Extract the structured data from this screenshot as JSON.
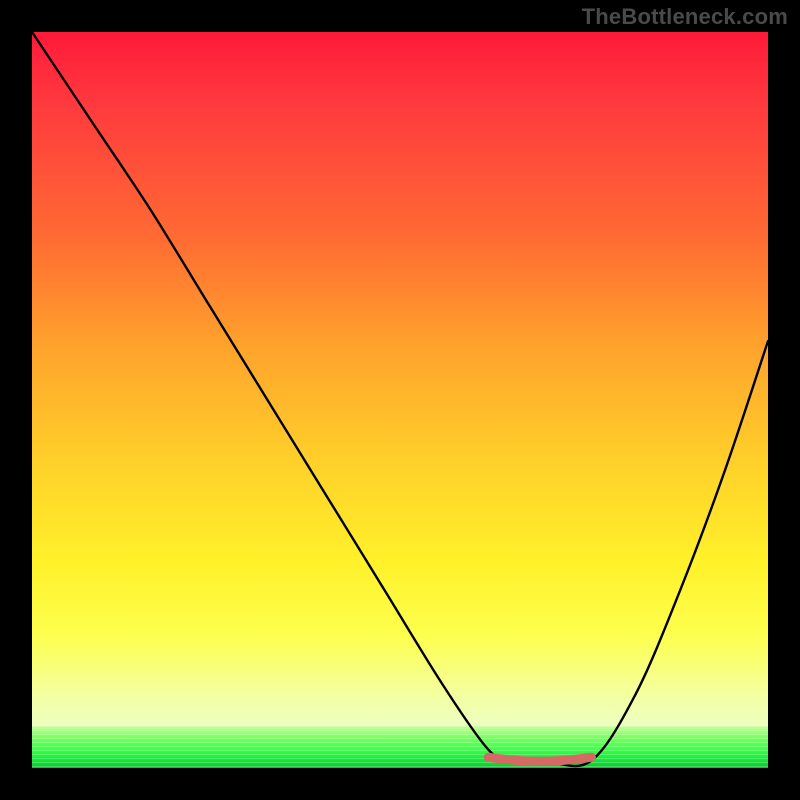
{
  "watermark": "TheBottleneck.com",
  "chart_data": {
    "type": "line",
    "title": "",
    "xlabel": "",
    "ylabel": "",
    "xlim": [
      0,
      100
    ],
    "ylim": [
      0,
      100
    ],
    "series": [
      {
        "name": "bottleneck-curve",
        "x": [
          0,
          8,
          16,
          24,
          32,
          40,
          48,
          56,
          62,
          65,
          70,
          76,
          82,
          88,
          94,
          100
        ],
        "values": [
          100,
          88,
          76,
          63,
          50,
          37,
          24,
          11,
          2.5,
          1,
          0.8,
          1,
          10,
          24,
          40,
          58
        ]
      }
    ],
    "marker": {
      "name": "optimal-range",
      "x_start": 62,
      "x_end": 76,
      "y": 1.2,
      "color": "#d46a63"
    },
    "background_gradient": {
      "top": "#ff1a3a",
      "mid": "#ffcf2a",
      "bottom": "#0cc52f"
    }
  }
}
